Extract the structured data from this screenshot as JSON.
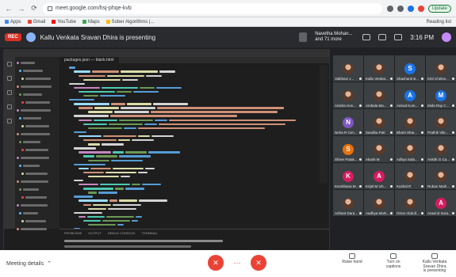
{
  "browser": {
    "url": "meet.google.com/hsj-phqe-kvb",
    "update_label": "Update",
    "bookmarks": [
      {
        "label": "Apps",
        "color": "#4285f4"
      },
      {
        "label": "Gmail",
        "color": "#ea4335"
      },
      {
        "label": "YouTube",
        "color": "#ff0000"
      },
      {
        "label": "Maps",
        "color": "#34a853"
      },
      {
        "label": "Sober Algorithms |...",
        "color": "#fbbc04"
      }
    ],
    "reading_list": "Reading list"
  },
  "meet": {
    "rec_label": "REC",
    "presenter_text": "Kallu Venkata Sravan Dhira is presenting",
    "top_participant": "Navetha Mohan... and 71 more",
    "clock": "3:16 PM",
    "participants": [
      {
        "name": "Vaibhavi J...",
        "initial": "",
        "color": "",
        "photo": true
      },
      {
        "name": "Kallu Venkat...",
        "initial": "",
        "color": "",
        "photo": true
      },
      {
        "name": "Shashank B...",
        "initial": "S",
        "color": "#1a73e8",
        "photo": false
      },
      {
        "name": "Kirti Chelve...",
        "initial": "",
        "color": "",
        "photo": true
      },
      {
        "name": "Anisha Hos...",
        "initial": "",
        "color": "",
        "photo": true
      },
      {
        "name": "Ambala Ma...",
        "initial": "",
        "color": "",
        "photo": true
      },
      {
        "name": "Anirud Kum...",
        "initial": "A",
        "color": "#1a73e8",
        "photo": false
      },
      {
        "name": "Mida Ray C...",
        "initial": "M",
        "color": "#1a73e8",
        "photo": false
      },
      {
        "name": "Neha R Cen...",
        "initial": "N",
        "color": "#7e57c2",
        "photo": false
      },
      {
        "name": "Sandha Pati",
        "initial": "",
        "color": "",
        "photo": true
      },
      {
        "name": "Bharti Shar...",
        "initial": "",
        "color": "",
        "photo": true
      },
      {
        "name": "Prathik Vikr...",
        "initial": "",
        "color": "",
        "photo": true
      },
      {
        "name": "Shree Patak...",
        "initial": "S",
        "color": "#e8710a",
        "photo": false
      },
      {
        "name": "Akash M",
        "initial": "",
        "color": "",
        "photo": true
      },
      {
        "name": "Adhya Sala...",
        "initial": "",
        "color": "",
        "photo": true
      },
      {
        "name": "Ankith G Ca...",
        "initial": "",
        "color": "",
        "photo": true
      },
      {
        "name": "Kesrithana M...",
        "initial": "K",
        "color": "#d81b60",
        "photo": false
      },
      {
        "name": "Kripit M Ich...",
        "initial": "A",
        "color": "#d81b60",
        "photo": false
      },
      {
        "name": "Kushal R",
        "initial": "",
        "color": "",
        "photo": true
      },
      {
        "name": "Ruban Maih...",
        "initial": "",
        "color": "",
        "photo": true
      },
      {
        "name": "Arihant Dara...",
        "initial": "",
        "color": "",
        "photo": true
      },
      {
        "name": "Aadhya Mark...",
        "initial": "",
        "color": "",
        "photo": true
      },
      {
        "name": "Omar Abdull...",
        "initial": "",
        "color": "",
        "photo": true
      },
      {
        "name": "Aravind Sura...",
        "initial": "A",
        "color": "#d81b60",
        "photo": false
      }
    ],
    "bottom": {
      "meeting_details": "Meeting details",
      "raise_hand": "Raise hand",
      "captions": "Turn on captions",
      "presenting": "Kallu Venkata Sravan Dhira is presenting"
    }
  },
  "ide": {
    "tab_label": "packages.json  —  blank.html",
    "terminal_tabs": [
      "PROBLEMS",
      "OUTPUT",
      "DEBUG CONSOLE",
      "TERMINAL"
    ]
  }
}
